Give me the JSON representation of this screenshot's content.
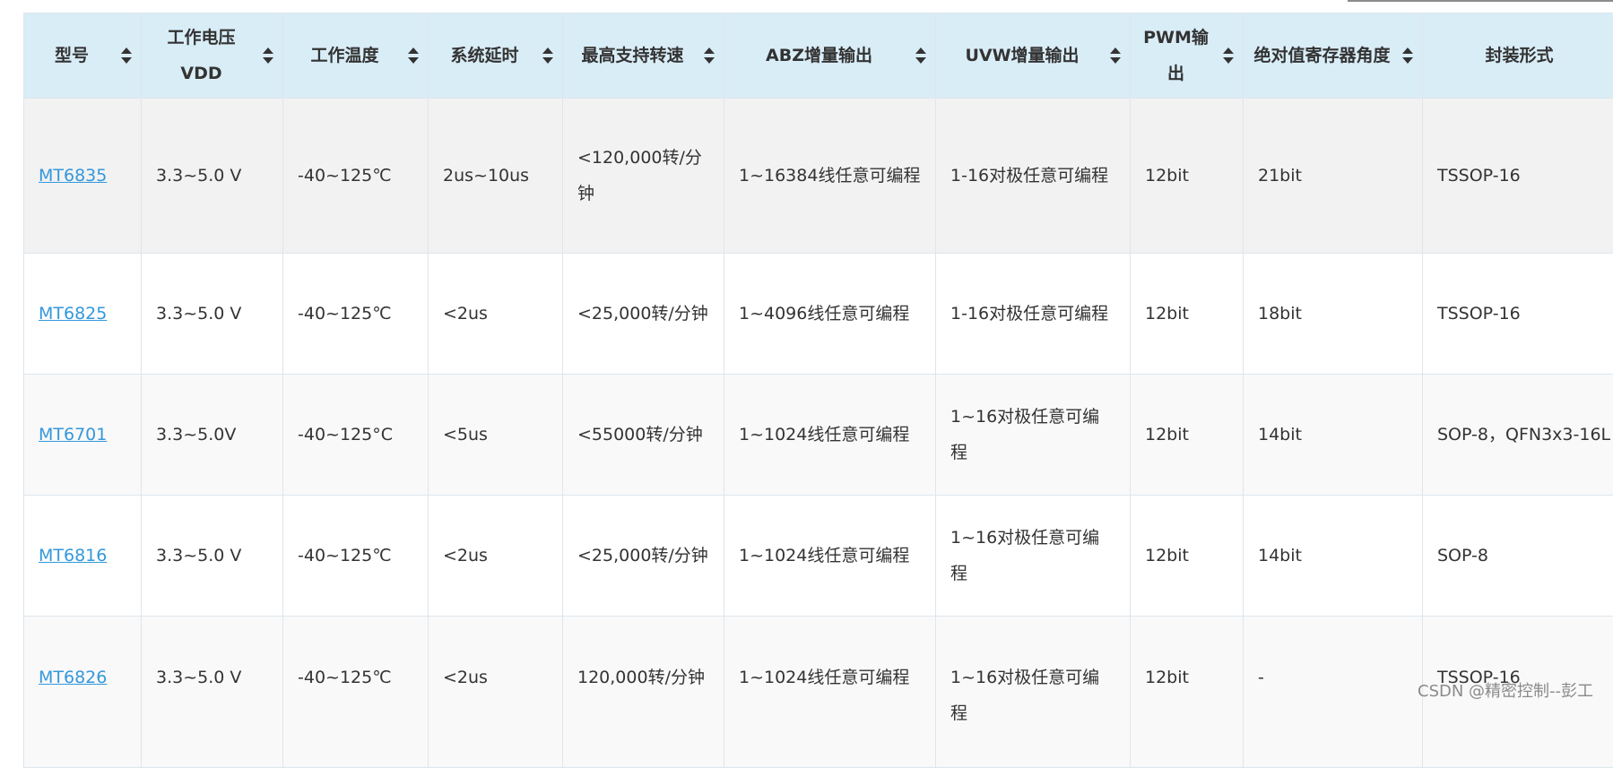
{
  "table": {
    "columns": [
      "型号",
      "工作电压 VDD",
      "工作温度",
      "系统延时",
      "最高支持转速",
      "ABZ增量输出",
      "UVW增量输出",
      "PWM输出",
      "绝对值寄存器角度",
      "封装形式"
    ],
    "rows": [
      {
        "model": "MT6835",
        "voltage": "3.3~5.0 V",
        "temperature": "-40~125℃",
        "delay": "2us~10us",
        "max_speed": "<120,000转/分钟",
        "abz": "1~16384线任意可编程",
        "uvw": "1-16对极任意可编程",
        "pwm": "12bit",
        "angle": "21bit",
        "package": "TSSOP-16"
      },
      {
        "model": "MT6825",
        "voltage": "3.3~5.0 V",
        "temperature": "-40~125℃",
        "delay": "<2us",
        "max_speed": "<25,000转/分钟",
        "abz": "1~4096线任意可编程",
        "uvw": "1-16对极任意可编程",
        "pwm": "12bit",
        "angle": "18bit",
        "package": "TSSOP-16"
      },
      {
        "model": "MT6701",
        "voltage": "3.3~5.0V",
        "temperature": "-40~125°C",
        "delay": "<5us",
        "max_speed": "<55000转/分钟",
        "abz": "1~1024线任意可编程",
        "uvw": "1~16对极任意可编程",
        "pwm": "12bit",
        "angle": "14bit",
        "package": "SOP-8，QFN3x3-16L"
      },
      {
        "model": "MT6816",
        "voltage": "3.3~5.0 V",
        "temperature": "-40~125℃",
        "delay": "<2us",
        "max_speed": "<25,000转/分钟",
        "abz": "1~1024线任意可编程",
        "uvw": "1~16对极任意可编程",
        "pwm": "12bit",
        "angle": "14bit",
        "package": "SOP-8"
      },
      {
        "model": "MT6826",
        "voltage": "3.3~5.0 V",
        "temperature": "-40~125℃",
        "delay": "<2us",
        "max_speed": "120,000转/分钟",
        "abz": "1~1024线任意可编程",
        "uvw": "1~16对极任意可编程",
        "pwm": "12bit",
        "angle": "-",
        "package": "TSSOP-16"
      }
    ]
  },
  "watermark": "CSDN @精密控制--彭工",
  "colors": {
    "header_bg": "#d9edf7",
    "link": "#3498db",
    "border": "#dde6ec"
  }
}
